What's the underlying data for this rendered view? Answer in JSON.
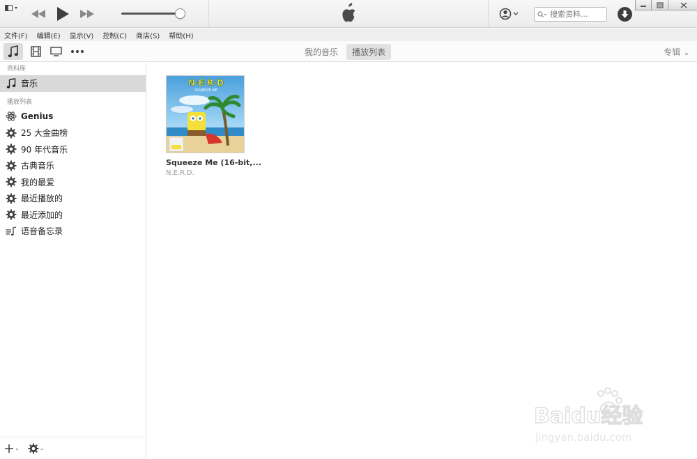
{
  "menu": [
    "文件(F)",
    "编辑(E)",
    "显示(V)",
    "控制(C)",
    "商店(S)",
    "帮助(H)"
  ],
  "search": {
    "placeholder": "搜索资料..."
  },
  "tabs": [
    {
      "label": "我的音乐",
      "active": false
    },
    {
      "label": "播放列表",
      "active": true
    }
  ],
  "view_select": "专辑 ⌄",
  "sidebar": {
    "library_title": "资料库",
    "library_items": [
      {
        "label": "音乐",
        "icon": "music-note-icon",
        "selected": true
      }
    ],
    "playlists_title": "播放列表",
    "playlists": [
      {
        "label": "Genius",
        "icon": "genius-atom-icon"
      },
      {
        "label": "25 大金曲榜",
        "icon": "smart-playlist-gear-icon"
      },
      {
        "label": "90 年代音乐",
        "icon": "smart-playlist-gear-icon"
      },
      {
        "label": "古典音乐",
        "icon": "smart-playlist-gear-icon"
      },
      {
        "label": "我的最爱",
        "icon": "smart-playlist-gear-icon"
      },
      {
        "label": "最近播放的",
        "icon": "smart-playlist-gear-icon"
      },
      {
        "label": "最近添加的",
        "icon": "smart-playlist-gear-icon"
      },
      {
        "label": "语音备忘录",
        "icon": "playlist-icon"
      }
    ]
  },
  "album": {
    "cover_band": "N·E·R·D",
    "cover_subtitle": "SQUEEZE ME",
    "title": "Squeeze Me (16-bit,...",
    "artist": "N.E.R.D."
  },
  "volume_level": 0.92,
  "watermark": {
    "brand": "Baidu经验",
    "url": "jingyan.baidu.com"
  },
  "colors": {
    "accent": "#3e3e3e",
    "selection": "#d9d9d9"
  }
}
